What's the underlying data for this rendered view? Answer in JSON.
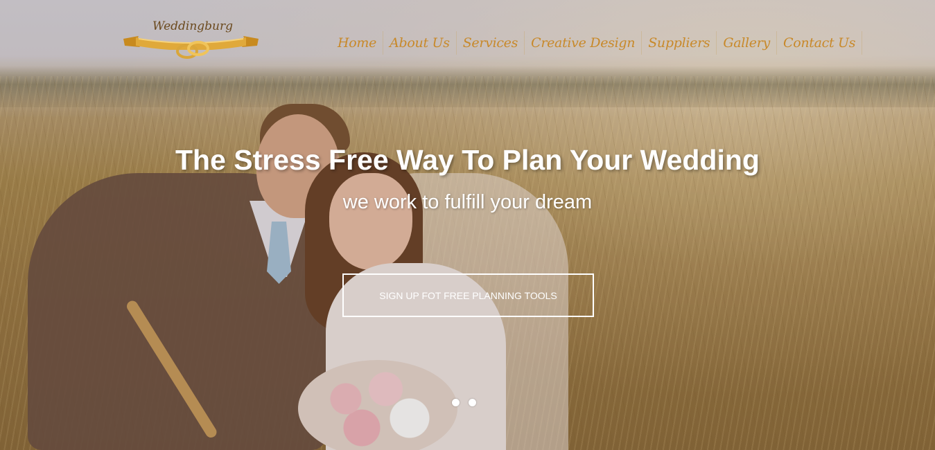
{
  "brand": {
    "logo_text": "Weddingburg",
    "colors": {
      "accent": "#c8892a",
      "ribbon": "#d4a032"
    }
  },
  "nav": {
    "items": [
      {
        "label": "Home"
      },
      {
        "label": "About Us"
      },
      {
        "label": "Services"
      },
      {
        "label": "Creative Design"
      },
      {
        "label": "Suppliers"
      },
      {
        "label": "Gallery"
      },
      {
        "label": "Contact Us"
      }
    ]
  },
  "hero": {
    "title": "The Stress Free Way To Plan Your Wedding",
    "subtitle": "we work to fulfill your dream",
    "cta_label": "SIGN UP FOT FREE PLANNING TOOLS",
    "slide_count": 2,
    "background_image": "couple-in-field-photo"
  }
}
